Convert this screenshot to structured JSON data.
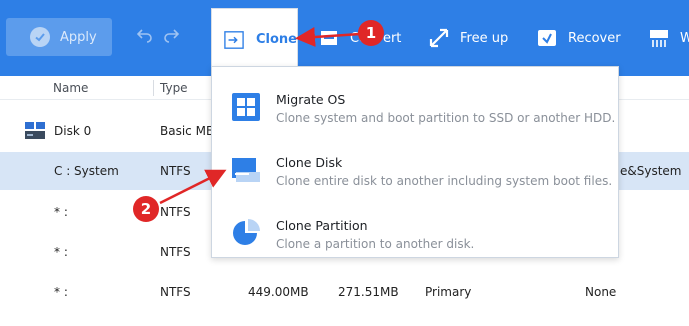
{
  "toolbar": {
    "apply_label": "Apply",
    "clone_label": "Clone",
    "convert_label": "Convert",
    "freeup_label": "Free up",
    "recover_label": "Recover",
    "partial_label": "W"
  },
  "table": {
    "headers": {
      "name": "Name",
      "type": "Type"
    },
    "rows": [
      {
        "name": "Disk 0",
        "type": "Basic MBR",
        "size": "",
        "used": "",
        "fs": "",
        "status": ""
      },
      {
        "name": "C : System",
        "type": "NTFS",
        "size": "",
        "used": "",
        "fs": "",
        "status": "e&System"
      },
      {
        "name": "* :",
        "type": "NTFS",
        "size": "",
        "used": "",
        "fs": "",
        "status": ""
      },
      {
        "name": "* :",
        "type": "NTFS",
        "size": "",
        "used": "",
        "fs": "",
        "status": ""
      },
      {
        "name": "* :",
        "type": "NTFS",
        "size": "449.00MB",
        "used": "271.51MB",
        "fs": "Primary",
        "status": "None"
      }
    ]
  },
  "dropdown": {
    "items": [
      {
        "title": "Migrate OS",
        "desc": "Clone system and boot partition to SSD or another HDD."
      },
      {
        "title": "Clone Disk",
        "desc": "Clone entire disk to another including system boot files."
      },
      {
        "title": "Clone Partition",
        "desc": "Clone a partition to another disk."
      }
    ]
  },
  "annotations": {
    "step1": "1",
    "step2": "2"
  },
  "colors": {
    "toolbar": "#2e7fe6",
    "selected_row": "#d7e5f6",
    "badge": "#e02727"
  }
}
